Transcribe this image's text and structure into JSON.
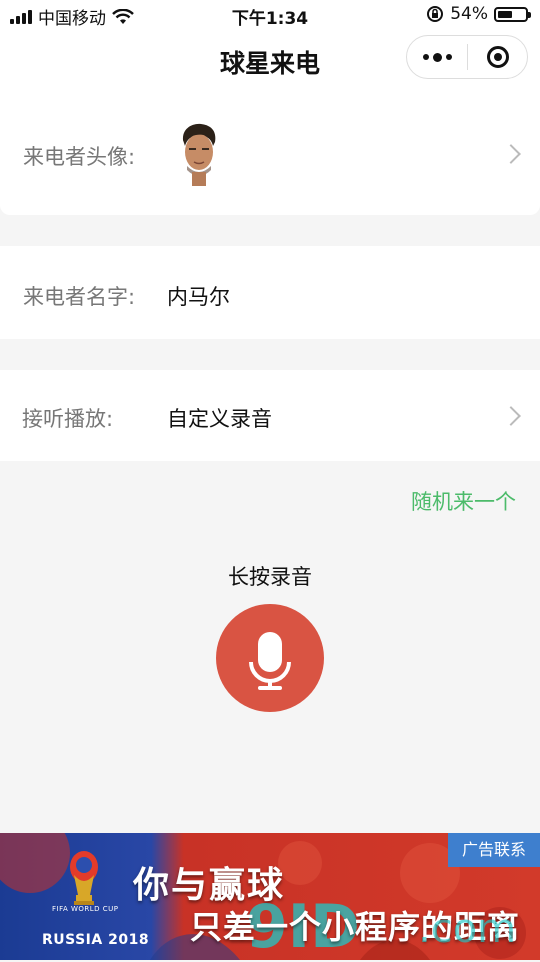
{
  "status_bar": {
    "carrier": "中国移动",
    "time": "下午1:34",
    "battery_percent": "54%",
    "battery_level": 0.54
  },
  "nav": {
    "title": "球星来电"
  },
  "form": {
    "avatar_label": "来电者头像:",
    "name_label": "来电者名字:",
    "name_value": "内马尔",
    "playback_label": "接听播放:",
    "playback_value": "自定义录音"
  },
  "actions": {
    "random_link": "随机来一个",
    "hold_to_record": "长按录音"
  },
  "banner": {
    "ad_contact": "广告联系",
    "slogan_line1": "你与赢球",
    "slogan_line2": "只差一个小程序的距离",
    "wc_top": "FIFA WORLD CUP",
    "wc_label": "RUSSIA 2018",
    "watermark": "9ID",
    "watermark_suffix": ".com"
  },
  "colors": {
    "accent_green": "#4cbb6a",
    "mic_red": "#d95443",
    "ad_blue": "#3e7fce"
  }
}
